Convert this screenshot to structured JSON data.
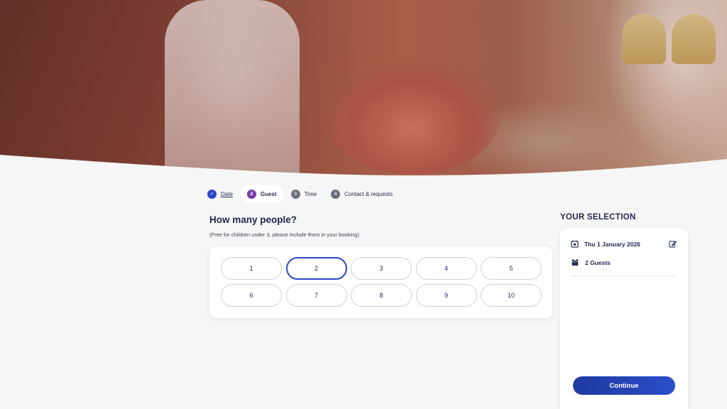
{
  "stepper": {
    "steps": [
      {
        "num": "✓",
        "label": "Date",
        "state": "done"
      },
      {
        "num": "2",
        "label": "Guest",
        "state": "active"
      },
      {
        "num": "3",
        "label": "Time",
        "state": "upcoming"
      },
      {
        "num": "4",
        "label": "Contact & requests",
        "state": "upcoming"
      }
    ]
  },
  "guests": {
    "question": "How many people?",
    "note": "(Free for children under 3, please include them in your booking)",
    "options": [
      "1",
      "2",
      "3",
      "4",
      "5",
      "6",
      "7",
      "8",
      "9",
      "10"
    ],
    "selected": "2"
  },
  "selection": {
    "title": "YOUR SELECTION",
    "date": "Thu 1 January 2026",
    "guests": "2 Guests",
    "continue_label": "Continue"
  },
  "colors": {
    "accent": "#2a47c9",
    "active_step": "#7a3ba8",
    "text": "#1f2750"
  },
  "icons": {
    "date_row": "calendar-icon",
    "guests_row": "group-icon",
    "edit": "edit-icon"
  }
}
